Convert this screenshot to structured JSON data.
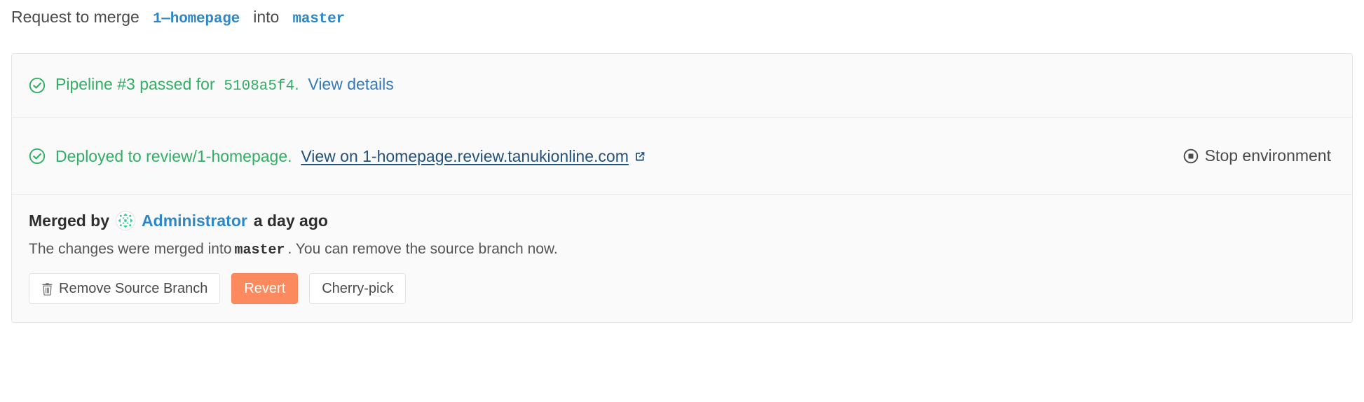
{
  "header": {
    "prefix": "Request to merge",
    "source_branch": "1—homepage",
    "middle": "into",
    "target_branch": "master"
  },
  "widget": {
    "pipeline": {
      "status_icon": "check-circle-icon",
      "text_before": "Pipeline #3 passed for",
      "sha": "5108a5f4",
      "period": ".",
      "details_link": "View details",
      "pipeline_number": "#3",
      "status": "passed"
    },
    "deploy": {
      "status_icon": "check-circle-icon",
      "text_before": "Deployed to review/1-homepage.",
      "environment": "review/1-homepage",
      "link": "View on 1-homepage.review.tanukionline.com",
      "external_icon": "external-link-icon",
      "stop_icon": "stop-circle-icon",
      "stop_label": "Stop environment"
    },
    "merged": {
      "merged_by_label": "Merged by",
      "avatar_icon": "identicon-avatar",
      "author": "Administrator",
      "time": "a day ago",
      "description_before": "The changes were merged into",
      "description_branch": "master",
      "description_after": ". You can remove the source branch now.",
      "buttons": [
        {
          "name": "remove-source-branch-button",
          "label": "Remove Source Branch",
          "icon": "trash-icon",
          "style": "default"
        },
        {
          "name": "revert-button",
          "label": "Revert",
          "icon": "",
          "style": "danger"
        },
        {
          "name": "cherry-pick-button",
          "label": "Cherry-pick",
          "icon": "",
          "style": "default"
        }
      ]
    }
  },
  "colors": {
    "success_green": "#31af64",
    "link_blue": "#337ab7",
    "branch_blue": "#2e87c7",
    "deploy_link": "#23527c",
    "danger_orange": "#fc8a5e",
    "panel_bg": "#fafafa",
    "panel_border": "#e5e5e5",
    "text_gray": "#4a4a4a"
  }
}
